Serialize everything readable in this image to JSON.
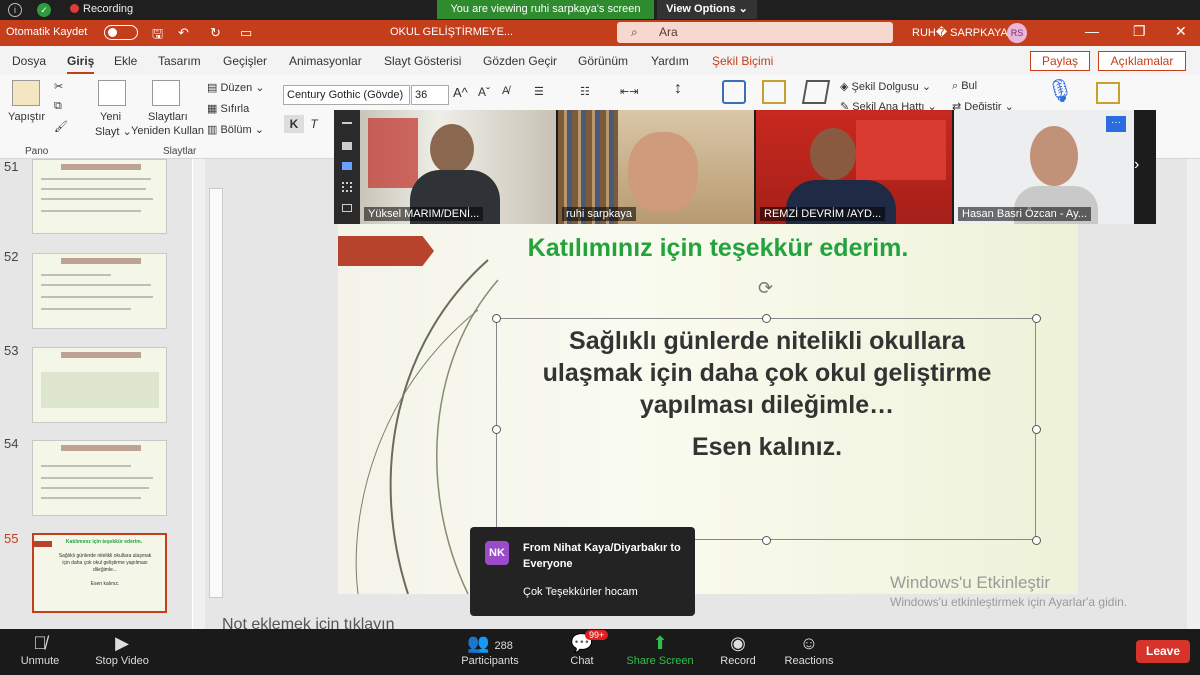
{
  "zoom_top": {
    "viewing_banner": "You are viewing ruhi sarpkaya's screen",
    "view_options": "View Options ⌄",
    "recording": "Recording"
  },
  "ppt": {
    "autosave_label": "Otomatik Kaydet",
    "file_name": "OKUL GELİŞTİRMEYE...",
    "search_placeholder": "Ara",
    "user_name": "RUH� SARPKAYA",
    "user_initials": "RS",
    "menu": [
      "Dosya",
      "Giriş",
      "Ekle",
      "Tasarım",
      "Geçişler",
      "Animasyonlar",
      "Slayt Gösterisi",
      "Gözden Geçir",
      "Görünüm",
      "Yardım",
      "Şekil Biçimi"
    ],
    "share_label": "Paylaş",
    "comments_label": "Açıklamalar",
    "ribbon": {
      "paste": "Yapıştır",
      "clipboard_group": "Pano",
      "new_slide_1": "Yeni",
      "new_slide_2": "Slayt ⌄",
      "reuse_1": "Slaytları",
      "reuse_2": "Yeniden Kullan",
      "slides_group": "Slaytlar",
      "layout": "Düzen ⌄",
      "reset": "Sıfırla",
      "section": "Bölüm ⌄",
      "font_name": "Century Gothic (Gövde)",
      "font_size": "36",
      "shape_fill": "Şekil Dolgusu ⌄",
      "shape_outline": "Şekil Ana Hattı ⌄",
      "find": "Bul",
      "replace": "Değiştir ⌄"
    }
  },
  "thumbnails": [
    {
      "num": "51"
    },
    {
      "num": "52"
    },
    {
      "num": "53"
    },
    {
      "num": "54"
    },
    {
      "num": "55"
    }
  ],
  "thumb55": {
    "title": "Katılımınız için teşekkür ederim.",
    "body": "Sağlıklı günlerde nitelikli okullara ulaşmak için daha çok okul geliştirme yapılması dileğimle...",
    "closing": "Esen kalınız."
  },
  "slide": {
    "title": "Katılımınız için teşekkür ederim.",
    "body_line1": "Sağlıklı günlerde nitelikli okullara",
    "body_line2": "ulaşmak için daha çok okul geliştirme",
    "body_line3": "yapılması dileğimle…",
    "closing": "Esen kalınız."
  },
  "notes_placeholder": "Not eklemek için tıklayın",
  "watermark": {
    "line1": "Windows'u Etkinleştir",
    "line2": "Windows'u etkinleştirmek için Ayarlar'a gidin."
  },
  "participants_video": [
    {
      "name": "Yüksel MARIM/DENİ..."
    },
    {
      "name": "ruhi sarpkaya"
    },
    {
      "name": "REMZİ DEVRİM /AYD..."
    },
    {
      "name": "Hasan Basri Özcan - Ay..."
    }
  ],
  "chat_toast": {
    "initials": "NK",
    "from": "From Nihat Kaya/Diyarbakır to Everyone",
    "message": "Çok Teşekkürler hocam"
  },
  "zoom_bottom": {
    "unmute": "Unmute",
    "stop_video": "Stop Video",
    "participants": "Participants",
    "participant_count": "288",
    "chat": "Chat",
    "chat_badge": "99+",
    "share_screen": "Share Screen",
    "record": "Record",
    "reactions": "Reactions",
    "leave": "Leave"
  },
  "colors": {
    "ppt_accent": "#c43e1c",
    "slide_title": "#24a33c",
    "zoom_green": "#2e8b2e",
    "leave_red": "#d6332a"
  }
}
